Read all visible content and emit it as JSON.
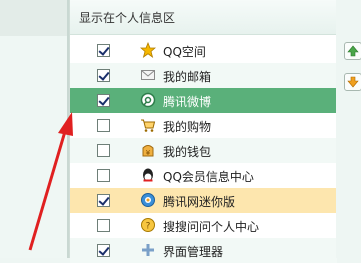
{
  "panel": {
    "title": "显示在个人信息区"
  },
  "items": [
    {
      "label": "QQ空间",
      "checked": true,
      "icon": "star-icon"
    },
    {
      "label": "我的邮箱",
      "checked": true,
      "icon": "mail-icon"
    },
    {
      "label": "腾讯微博",
      "checked": true,
      "icon": "weibo-icon",
      "state": "selected"
    },
    {
      "label": "我的购物",
      "checked": false,
      "icon": "cart-icon"
    },
    {
      "label": "我的钱包",
      "checked": false,
      "icon": "wallet-icon"
    },
    {
      "label": "QQ会员信息中心",
      "checked": false,
      "icon": "qq-vip-icon"
    },
    {
      "label": "腾讯网迷你版",
      "checked": true,
      "icon": "minisite-icon",
      "state": "highlight"
    },
    {
      "label": "搜搜问问个人中心",
      "checked": false,
      "icon": "soso-wenwen-icon"
    },
    {
      "label": "界面管理器",
      "checked": true,
      "icon": "plus-icon"
    }
  ],
  "side_buttons": [
    {
      "name": "move-up",
      "icon": "arrow-up-icon"
    },
    {
      "name": "move-down",
      "icon": "arrow-down-icon"
    }
  ],
  "colors": {
    "selected_row": "#5ab07a",
    "highlight_row": "#fde6ae",
    "annotation_arrow": "#e02020"
  }
}
